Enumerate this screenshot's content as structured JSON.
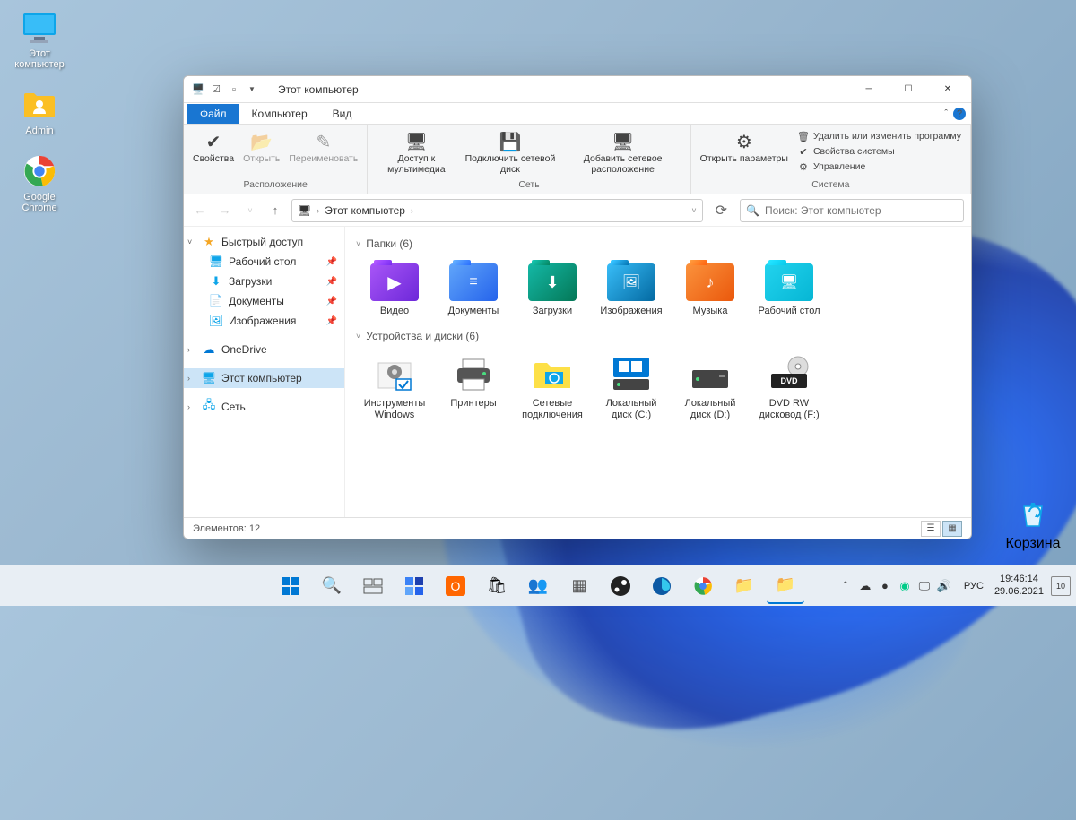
{
  "desktop": {
    "icons": [
      {
        "label": "Этот компьютер"
      },
      {
        "label": "Admin"
      },
      {
        "label": "Google Chrome"
      }
    ],
    "recycle": "Корзина"
  },
  "window": {
    "title": "Этот компьютер",
    "tabs": {
      "file": "Файл",
      "computer": "Компьютер",
      "view": "Вид"
    },
    "ribbon": {
      "grp1": {
        "title": "Расположение",
        "btn1": "Свойства",
        "btn2": "Открыть",
        "btn3": "Переименовать"
      },
      "grp2": {
        "title": "Сеть",
        "btn1": "Доступ к мультимедиа",
        "btn2": "Подключить сетевой диск",
        "btn3": "Добавить сетевое расположение"
      },
      "grp3": {
        "title": "Система",
        "btn1": "Открыть параметры",
        "s1": "Удалить или изменить программу",
        "s2": "Свойства системы",
        "s3": "Управление"
      }
    },
    "addr": {
      "this_pc": "Этот компьютер"
    },
    "search_placeholder": "Поиск: Этот компьютер",
    "sidebar": {
      "quick": "Быстрый доступ",
      "desktop": "Рабочий стол",
      "downloads": "Загрузки",
      "documents": "Документы",
      "pictures": "Изображения",
      "onedrive": "OneDrive",
      "this_pc": "Этот компьютер",
      "network": "Сеть"
    },
    "sections": {
      "folders_hdr": "Папки (6)",
      "drives_hdr": "Устройства и диски (6)"
    },
    "folders": [
      {
        "label": "Видео"
      },
      {
        "label": "Документы"
      },
      {
        "label": "Загрузки"
      },
      {
        "label": "Изображения"
      },
      {
        "label": "Музыка"
      },
      {
        "label": "Рабочий стол"
      }
    ],
    "drives": [
      {
        "label": "Инструменты Windows"
      },
      {
        "label": "Принтеры"
      },
      {
        "label": "Сетевые подключения"
      },
      {
        "label": "Локальный диск (C:)"
      },
      {
        "label": "Локальный диск (D:)"
      },
      {
        "label": "DVD RW дисковод (F:)"
      }
    ],
    "status": "Элементов: 12"
  },
  "taskbar": {
    "lang": "РУС",
    "time": "19:46:14",
    "date": "29.06.2021",
    "notif": "10"
  }
}
